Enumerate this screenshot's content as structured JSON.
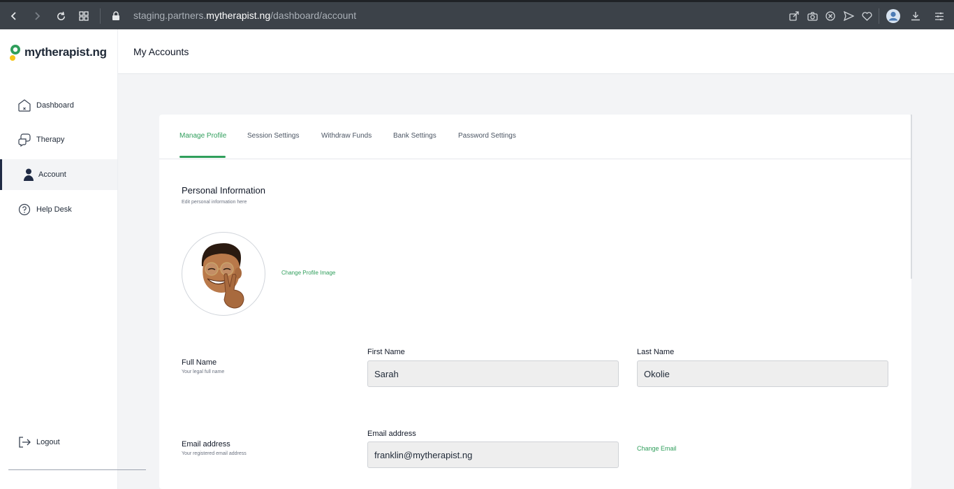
{
  "browser": {
    "url_prefix": "staging.partners.",
    "url_domain": "mytherapist.ng",
    "url_path": "/dashboard/account"
  },
  "sidebar": {
    "logo_text": "mytherapist.ng",
    "items": [
      {
        "label": "Dashboard",
        "icon": "home-icon"
      },
      {
        "label": "Therapy",
        "icon": "chat-icon"
      },
      {
        "label": "Account",
        "icon": "user-icon"
      },
      {
        "label": "Help Desk",
        "icon": "help-icon"
      }
    ],
    "logout_label": "Logout"
  },
  "header": {
    "title": "My Accounts"
  },
  "tabs": [
    {
      "label": "Manage Profile"
    },
    {
      "label": "Session Settings"
    },
    {
      "label": "Withdraw Funds"
    },
    {
      "label": "Bank Settings"
    },
    {
      "label": "Password Settings"
    }
  ],
  "profile": {
    "section_title": "Personal Information",
    "section_subtitle": "Edit personal information here",
    "change_image_label": "Change Profile Image",
    "full_name_label": "Full Name",
    "full_name_sub": "Your legal full name",
    "first_name_label": "First Name",
    "first_name_value": "Sarah",
    "last_name_label": "Last Name",
    "last_name_value": "Okolie",
    "email_row_label": "Email address",
    "email_row_sub": "Your registered email address",
    "email_field_label": "Email address",
    "email_value": "franklin@mytherapist.ng",
    "change_email_label": "Change Email"
  },
  "colors": {
    "accent": "#2f9e5b",
    "dark": "#1f2a44"
  }
}
